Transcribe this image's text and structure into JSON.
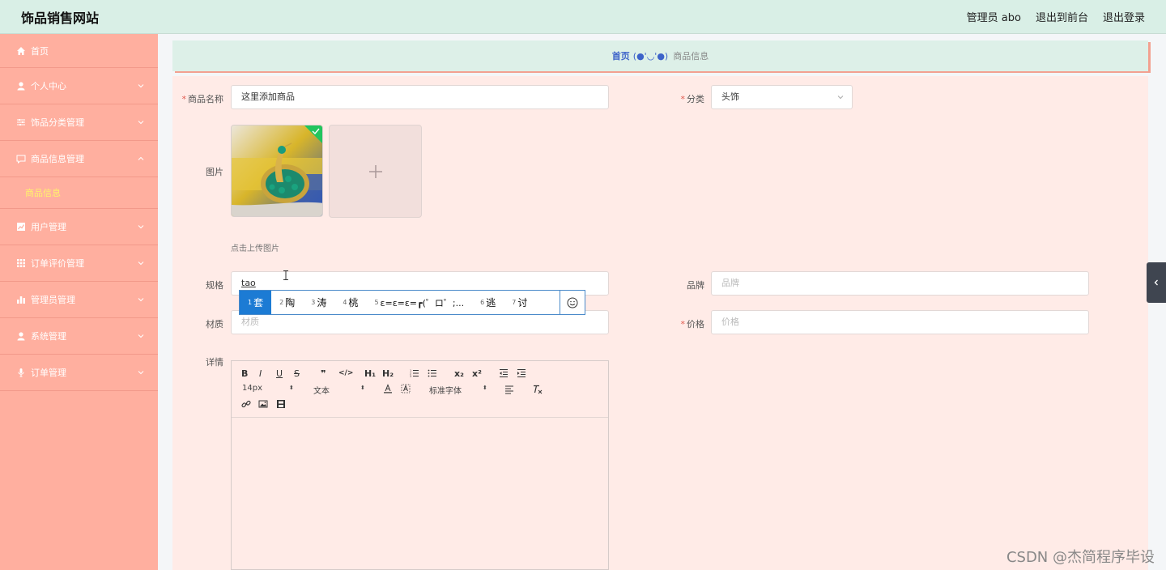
{
  "header": {
    "brand": "饰品销售网站",
    "admin_label": "管理员 abo",
    "exit_front_label": "退出到前台",
    "logout_label": "退出登录"
  },
  "sidebar": {
    "items": [
      {
        "label": "首页",
        "icon": "home-icon"
      },
      {
        "label": "个人中心",
        "icon": "user-icon"
      },
      {
        "label": "饰品分类管理",
        "icon": "sliders-icon"
      },
      {
        "label": "商品信息管理",
        "icon": "message-icon",
        "expanded": true
      },
      {
        "label": "用户管理",
        "icon": "chart-icon"
      },
      {
        "label": "订单评价管理",
        "icon": "grid-icon"
      },
      {
        "label": "管理员管理",
        "icon": "bar-chart-icon"
      },
      {
        "label": "系统管理",
        "icon": "user-icon"
      },
      {
        "label": "订单管理",
        "icon": "microphone-icon"
      }
    ],
    "sub_item": "商品信息",
    "colors": {
      "bg": "#ffaf9f",
      "active_sub": "#fff36b"
    }
  },
  "breadcrumb": {
    "home": "首页",
    "face": "(●'◡'●)",
    "current": "商品信息"
  },
  "form": {
    "name_label": "商品名称",
    "name_value": "这里添加商品",
    "category_label": "分类",
    "category_value": "头饰",
    "image_label": "图片",
    "upload_hint": "点击上传图片",
    "spec_label": "规格",
    "spec_value": "tao",
    "brand_label": "品牌",
    "brand_placeholder": "品牌",
    "material_label": "材质",
    "material_placeholder": "材质",
    "price_label": "价格",
    "price_placeholder": "价格",
    "detail_label": "详情"
  },
  "ime": {
    "candidates": [
      {
        "num": "1",
        "text": "套"
      },
      {
        "num": "2",
        "text": "陶"
      },
      {
        "num": "3",
        "text": "涛"
      },
      {
        "num": "4",
        "text": "桃"
      },
      {
        "num": "5",
        "text": "ε=ε=ε=┏(゜ロ゜;..."
      },
      {
        "num": "6",
        "text": "逃"
      },
      {
        "num": "7",
        "text": "讨"
      }
    ]
  },
  "editor": {
    "font_size": "14px",
    "text_style": "文本",
    "font_family": "标准字体",
    "buttons": [
      "B",
      "I",
      "U",
      "S",
      "❞",
      "</>",
      "H₁",
      "H₂",
      "x₂",
      "x²"
    ]
  },
  "watermark": "CSDN @杰简程序毕设"
}
